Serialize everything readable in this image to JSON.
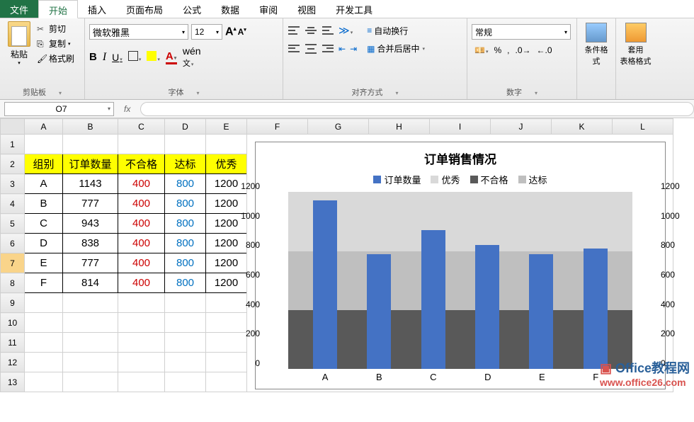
{
  "tabs": {
    "file": "文件",
    "home": "开始",
    "insert": "插入",
    "layout": "页面布局",
    "formula": "公式",
    "data": "数据",
    "review": "审阅",
    "view": "视图",
    "dev": "开发工具"
  },
  "ribbon": {
    "clipboard": {
      "label": "剪贴板",
      "paste": "粘贴",
      "cut": "剪切",
      "copy": "复制",
      "painter": "格式刷"
    },
    "font": {
      "label": "字体",
      "name": "微软雅黑",
      "size": "12"
    },
    "align": {
      "label": "对齐方式",
      "wrap": "自动换行",
      "merge": "合并后居中"
    },
    "number": {
      "label": "数字",
      "format": "常规"
    },
    "style": {
      "cond": "条件格式",
      "table": "套用\n表格格式"
    }
  },
  "namebox": "O7",
  "cols": [
    "A",
    "B",
    "C",
    "D",
    "E",
    "F",
    "G",
    "H",
    "I",
    "J",
    "K",
    "L"
  ],
  "rows": [
    "1",
    "2",
    "3",
    "4",
    "5",
    "6",
    "7",
    "8",
    "9",
    "10",
    "11",
    "12",
    "13"
  ],
  "table": {
    "headers": [
      "组别",
      "订单数量",
      "不合格",
      "达标",
      "优秀"
    ],
    "rows": [
      {
        "g": "A",
        "q": "1143",
        "f": "400",
        "s": "800",
        "e": "1200"
      },
      {
        "g": "B",
        "q": "777",
        "f": "400",
        "s": "800",
        "e": "1200"
      },
      {
        "g": "C",
        "q": "943",
        "f": "400",
        "s": "800",
        "e": "1200"
      },
      {
        "g": "D",
        "q": "838",
        "f": "400",
        "s": "800",
        "e": "1200"
      },
      {
        "g": "E",
        "q": "777",
        "f": "400",
        "s": "800",
        "e": "1200"
      },
      {
        "g": "F",
        "q": "814",
        "f": "400",
        "s": "800",
        "e": "1200"
      }
    ]
  },
  "chart_data": {
    "type": "bar",
    "title": "订单销售情况",
    "legend": [
      "订单数量",
      "优秀",
      "不合格",
      "达标"
    ],
    "legend_colors": [
      "#4472c4",
      "#d9d9d9",
      "#595959",
      "#bfbfbf"
    ],
    "categories": [
      "A",
      "B",
      "C",
      "D",
      "E",
      "F"
    ],
    "values": [
      1143,
      777,
      943,
      838,
      777,
      814
    ],
    "bands": {
      "不合格": 400,
      "达标": 800,
      "优秀": 1200
    },
    "ylim": [
      0,
      1200
    ],
    "yticks": [
      0,
      200,
      400,
      600,
      800,
      1000,
      1200
    ],
    "yticks_right": [
      0,
      200,
      400,
      600,
      800,
      1000,
      1200
    ]
  },
  "watermark": {
    "line1": "Office教程网",
    "line2": "www.office26.com"
  }
}
